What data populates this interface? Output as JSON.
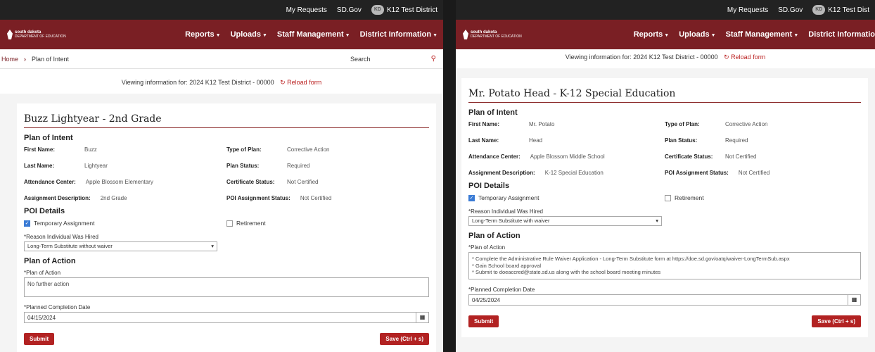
{
  "header": {
    "my_requests": "My Requests",
    "sd_gov": "SD.Gov",
    "avatar_initials": "KD",
    "district": "K12 Test District",
    "district_right": "K12 Test Dist"
  },
  "brand": {
    "line1": "south dakota",
    "line2": "DEPARTMENT OF EDUCATION"
  },
  "nav": {
    "reports": "Reports",
    "uploads": "Uploads",
    "staff": "Staff Management",
    "district_info": "District Information",
    "district_info_right": "District Informatio"
  },
  "crumbs": {
    "home": "Home",
    "current": "Plan of Intent"
  },
  "search_label": "Search",
  "viewing": {
    "prefix": "Viewing information for:",
    "district": "2024 K12 Test District - 00000",
    "reload": "Reload form"
  },
  "labels": {
    "plan_of_intent": "Plan of Intent",
    "first_name": "First Name:",
    "last_name": "Last Name:",
    "attendance_center": "Attendance Center:",
    "assignment_description": "Assignment Description:",
    "type_of_plan": "Type of Plan:",
    "plan_status": "Plan Status:",
    "certificate_status": "Certificate Status:",
    "poi_assignment_status": "POI Assignment Status:",
    "poi_details": "POI Details",
    "temporary_assignment": "Temporary Assignment",
    "retirement": "Retirement",
    "reason_hired": "Reason Individual Was Hired",
    "plan_of_action": "Plan of Action",
    "plan_of_action_field": "Plan of Action",
    "planned_completion": "Planned Completion Date",
    "required_mark": "*",
    "submit": "Submit",
    "save": "Save (Ctrl + s)"
  },
  "left": {
    "title": "Buzz Lightyear - 2nd Grade",
    "first_name": "Buzz",
    "last_name": "Lightyear",
    "attendance_center": "Apple Blossom Elementary",
    "assignment_description": "2nd Grade",
    "type_of_plan": "Corrective Action",
    "plan_status": "Required",
    "certificate_status": "Not Certified",
    "poi_assignment_status": "Not Certified",
    "temporary_assignment_checked": true,
    "retirement_checked": false,
    "reason_hired": "Long-Term Substitute without waiver",
    "plan_of_action": [
      "No further action"
    ],
    "planned_completion": "04/15/2024"
  },
  "right": {
    "title": "Mr. Potato Head - K-12 Special Education",
    "first_name": "Mr. Potato",
    "last_name": "Head",
    "attendance_center": "Apple Blossom Middle School",
    "assignment_description": "K-12 Special Education",
    "type_of_plan": "Corrective Action",
    "plan_status": "Required",
    "certificate_status": "Not Certified",
    "poi_assignment_status": "Not Certified",
    "temporary_assignment_checked": true,
    "retirement_checked": false,
    "reason_hired": "Long-Term Substitute with waiver",
    "plan_of_action": [
      "* Complete the Administrative Rule Waiver Application - Long-Term Substitute form at https://doe.sd.gov/oatq/waiver-LongTermSub.aspx",
      "* Gain School board approval",
      "* Submit to doeaccred@state.sd.us along with the school board meeting minutes"
    ],
    "planned_completion": "04/25/2024"
  }
}
